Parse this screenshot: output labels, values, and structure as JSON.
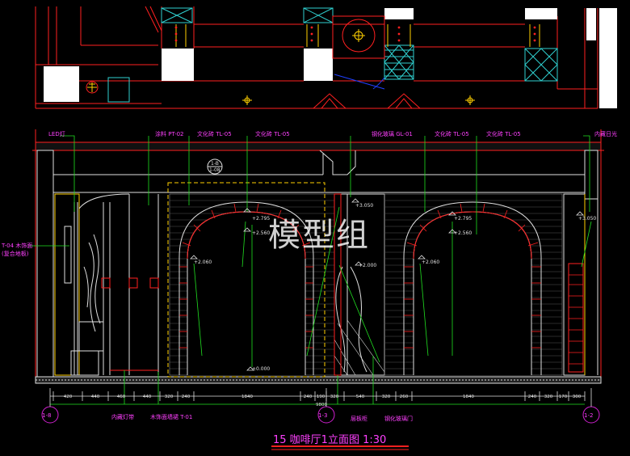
{
  "labels_top": {
    "led": "LED灯",
    "paint": "涂料 PT-02",
    "tile1": "文化砖 TL-05",
    "tile2": "文化砖 TL-05",
    "glass": "钢化玻璃 GL-01",
    "tile3": "文化砖 TL-05",
    "tile4": "文化砖 TL-05",
    "hidden_light": "内藏日光"
  },
  "labels_left": {
    "wood_line1": "T-04 木饰面",
    "wood_line2": "(复合地板)"
  },
  "section_marker": {
    "top": "1-B",
    "bottom": "1-08"
  },
  "levels": {
    "l1": "+2.795",
    "l2": "+2.560",
    "l3": "+2.060",
    "l4": "+3.050",
    "l5": "+2.000",
    "l6": "+2.795",
    "l7": "+2.560",
    "l8": "+2.060",
    "l9": "+3.050",
    "l10": "±0.000"
  },
  "dimensions": [
    "420",
    "440",
    "460",
    "440",
    "320",
    "240",
    "1840",
    "240",
    "190",
    "320",
    "540",
    "320",
    "260",
    "1840",
    "240",
    "320",
    "170",
    "300"
  ],
  "total_dim": "9800",
  "labels_bottom": {
    "strip": "内藏灯带",
    "wood_wall": "木饰面墙裙 T-01",
    "shelf": "层板柜",
    "glass_door": "钢化玻璃门"
  },
  "axis_markers": [
    "1-8",
    "1-3",
    "1-2"
  ],
  "title": "15 咖啡厅1立面图 1:30",
  "watermark": "模型组"
}
